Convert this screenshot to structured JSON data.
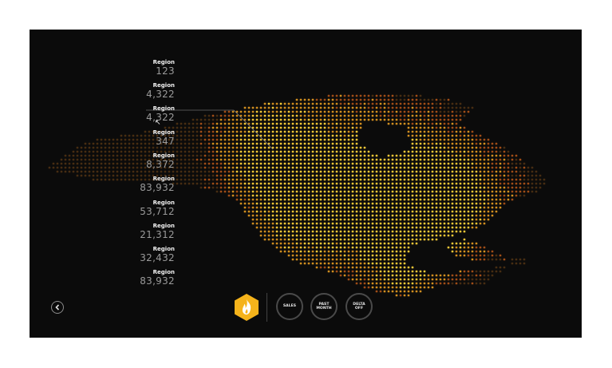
{
  "regions": [
    {
      "label": "Region",
      "value": "123"
    },
    {
      "label": "Region",
      "value": "4,322"
    },
    {
      "label": "Region",
      "value": "4,322"
    },
    {
      "label": "Region",
      "value": "347"
    },
    {
      "label": "Region",
      "value": "8,372"
    },
    {
      "label": "Region",
      "value": "83,932"
    },
    {
      "label": "Region",
      "value": "53,712"
    },
    {
      "label": "Region",
      "value": "21,312"
    },
    {
      "label": "Region",
      "value": "32,432"
    },
    {
      "label": "Region",
      "value": "83,932"
    }
  ],
  "toolbar": {
    "sales_label": "SALES",
    "past_month_label": "PAST MONTH",
    "delta_off_label": "DELTA OFF"
  },
  "icons": {
    "back": "chevron-left-icon",
    "fire": "flame-icon"
  },
  "colors": {
    "background": "#0b0b0b",
    "accent": "#f5b31b",
    "heat_low": "#6b3a12",
    "heat_mid": "#f07a1e",
    "heat_high": "#ffd23a"
  }
}
